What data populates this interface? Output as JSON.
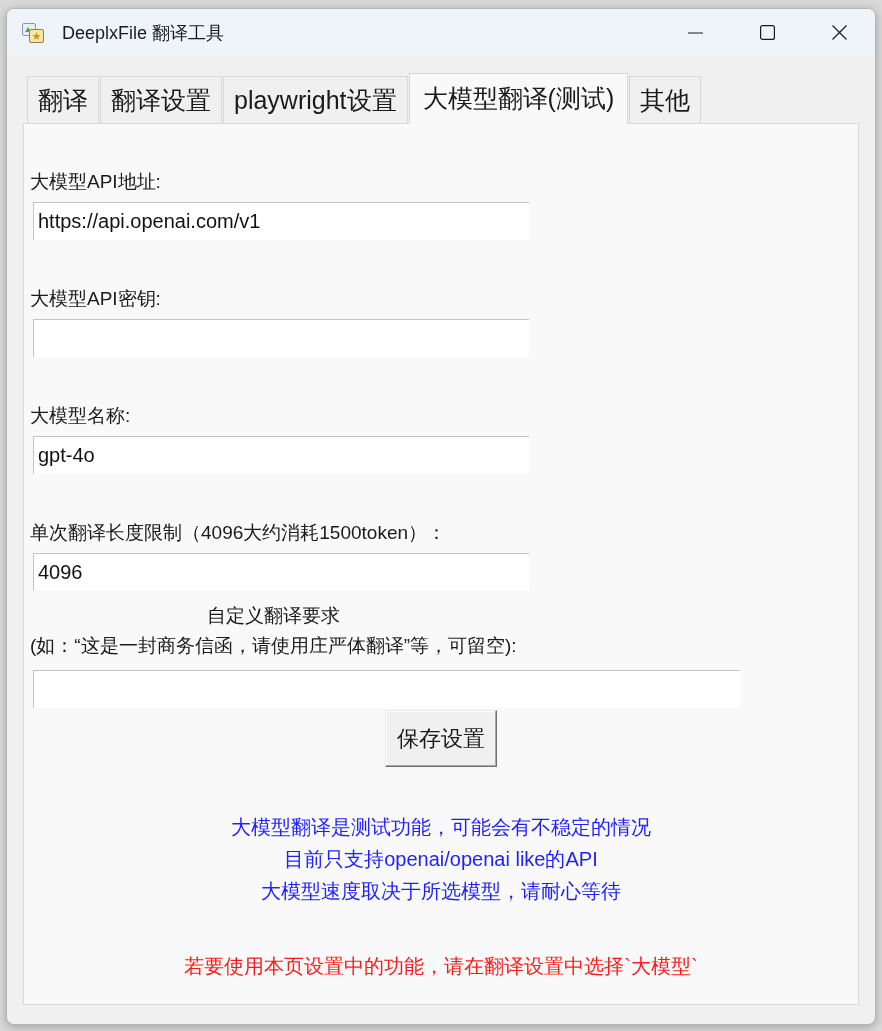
{
  "window": {
    "title": "DeeplxFile 翻译工具"
  },
  "tabs": [
    {
      "label": "翻译",
      "selected": false
    },
    {
      "label": "翻译设置",
      "selected": false
    },
    {
      "label": "playwright设置",
      "selected": false
    },
    {
      "label": "大模型翻译(测试)",
      "selected": true
    },
    {
      "label": "其他",
      "selected": false
    }
  ],
  "fields": [
    {
      "label": "大模型API地址:",
      "value": "https://api.openai.com/v1"
    },
    {
      "label": "大模型API密钥:"
    },
    {
      "label": "大模型名称:",
      "value": "gpt-4o"
    },
    {
      "label": "单次翻译长度限制（4096大约消耗1500token）：",
      "value": "4096"
    }
  ],
  "custom_prompt": {
    "title": "自定义翻译要求",
    "hint": "(如：“这是一封商务信函，请使用庄严体翻译”等，可留空):"
  },
  "save_button": "保存设置",
  "info_notes": [
    "大模型翻译是测试功能，可能会有不稳定的情况",
    "目前只支持openai/openai like的API",
    "大模型速度取决于所选模型，请耐心等待"
  ],
  "warning_note": "若要使用本页设置中的功能，请在翻译设置中选择`大模型`"
}
